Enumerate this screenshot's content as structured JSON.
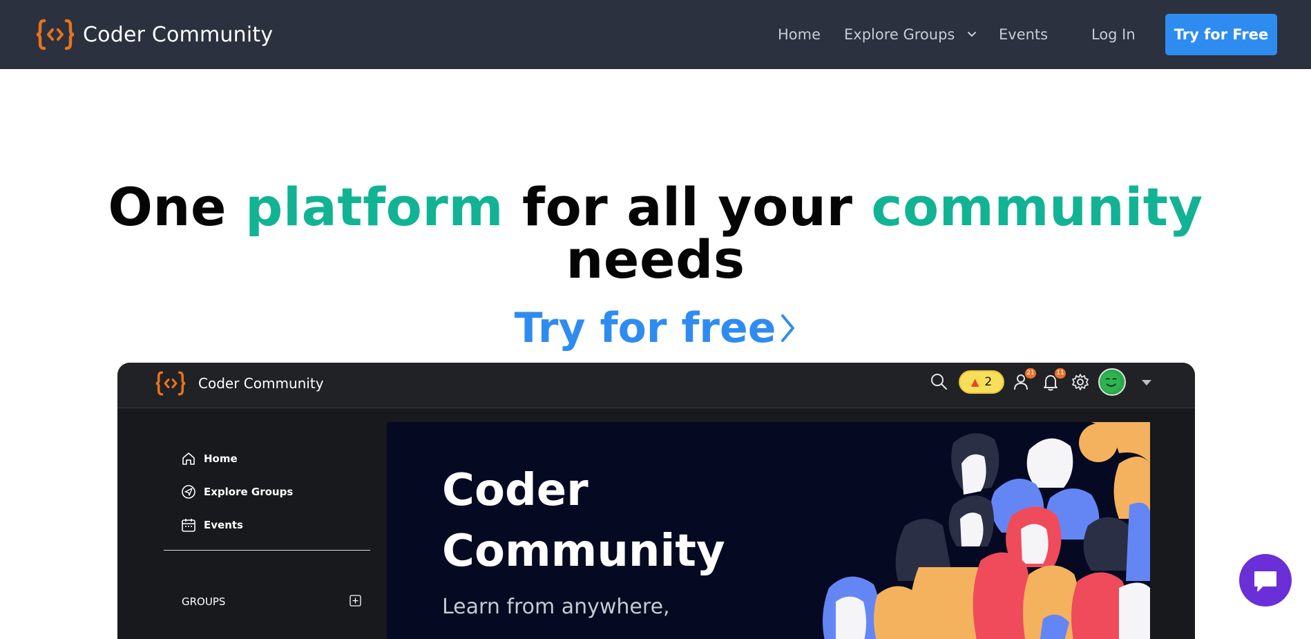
{
  "colors": {
    "navbar": "#2b313f",
    "accent_green": "#12b394",
    "accent_blue": "#2e8cf0",
    "logo_orange": "#e8741c",
    "chat_purple": "#6a2fd6"
  },
  "nav": {
    "brand": "Coder Community",
    "links": {
      "home": "Home",
      "explore": "Explore Groups",
      "events": "Events",
      "login": "Log In"
    },
    "cta": "Try for Free"
  },
  "hero": {
    "line1": {
      "w1": "One ",
      "w2": "platform",
      "w3": " for all your ",
      "w4": "community"
    },
    "line2": "needs",
    "cta": "Try for free"
  },
  "preview": {
    "brand": "Coder Community",
    "streak": "2",
    "friends_count": "21",
    "notifications_count": "11",
    "sidebar": {
      "home": "Home",
      "explore": "Explore Groups",
      "events": "Events",
      "groups": "GROUPS"
    },
    "banner": {
      "title_line1": "Coder",
      "title_line2": "Community",
      "subtitle": "Learn from anywhere,"
    }
  }
}
